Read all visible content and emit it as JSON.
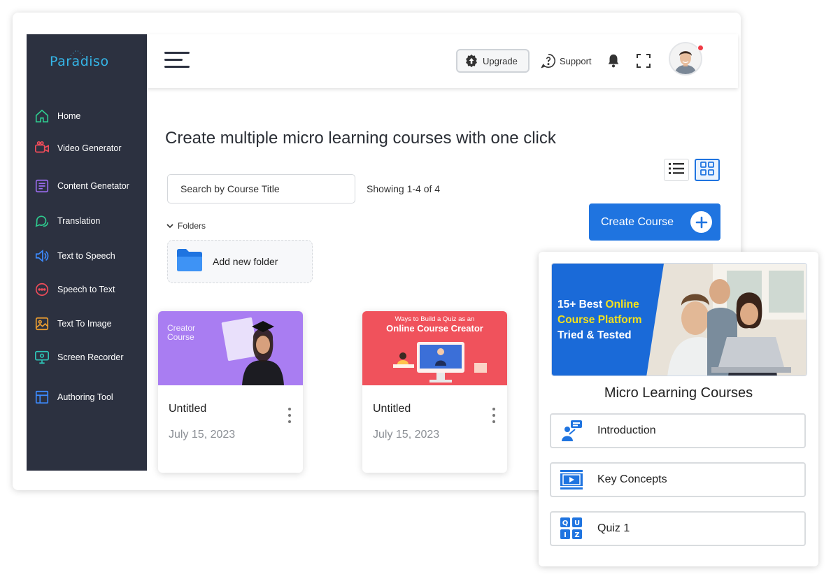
{
  "app": {
    "brand": "Paradiso"
  },
  "sidebar": {
    "items": [
      {
        "label": "Home",
        "icon": "home-icon",
        "color": "#2ecc8f"
      },
      {
        "label": "Video Generator",
        "icon": "video-camera-icon",
        "color": "#ef4c5a"
      },
      {
        "label": "Content Genetator",
        "icon": "document-icon",
        "color": "#9b6cf0"
      },
      {
        "label": "Translation",
        "icon": "chat-bubbles-icon",
        "color": "#2ecc8f"
      },
      {
        "label": "Text to Speech",
        "icon": "speaker-icon",
        "color": "#3d8bff"
      },
      {
        "label": "Speech to Text",
        "icon": "speech-bubble-icon",
        "color": "#ef4c5a"
      },
      {
        "label": "Text To Image",
        "icon": "image-icon",
        "color": "#f0a030"
      },
      {
        "label": "Screen Recorder",
        "icon": "monitor-icon",
        "color": "#2ec4b6"
      },
      {
        "label": "Authoring Tool",
        "icon": "layout-icon",
        "color": "#3d8bff"
      }
    ]
  },
  "header": {
    "upgrade_label": "Upgrade",
    "support_label": "Support"
  },
  "main": {
    "title": "Create multiple micro learning courses with one click",
    "search_placeholder": "Search by Course Title",
    "showing_text": "Showing 1-4 of 4",
    "create_button_label": "Create Course",
    "folders_label": "Folders",
    "add_folder_label": "Add new folder",
    "courses": [
      {
        "title": "Untitled",
        "date": "July 15, 2023",
        "thumb_heading": "Creator Course",
        "thumb_heading_1": "Creator",
        "thumb_heading_2": "Course",
        "thumb_color": "#a87ef0"
      },
      {
        "title": "Untitled",
        "date": "July 15, 2023",
        "thumb_heading_1": "Ways to Build a Quiz as an",
        "thumb_heading_2": "Online Course Creator",
        "thumb_color": "#f04f5a"
      }
    ]
  },
  "panel": {
    "promo_line1_a": "15+ Best",
    "promo_line1_b": "Online",
    "promo_line2": "Course Platform",
    "promo_line3": "Tried & Tested",
    "promo_color": "#1a6ad8",
    "title": "Micro Learning Courses",
    "lessons": [
      {
        "label": "Introduction",
        "icon": "presenter-icon"
      },
      {
        "label": "Key Concepts",
        "icon": "film-icon"
      },
      {
        "label": "Quiz 1",
        "icon": "quiz-icon"
      }
    ]
  },
  "colors": {
    "accent": "#1f74e0",
    "sidebar_bg": "#2c3140"
  }
}
